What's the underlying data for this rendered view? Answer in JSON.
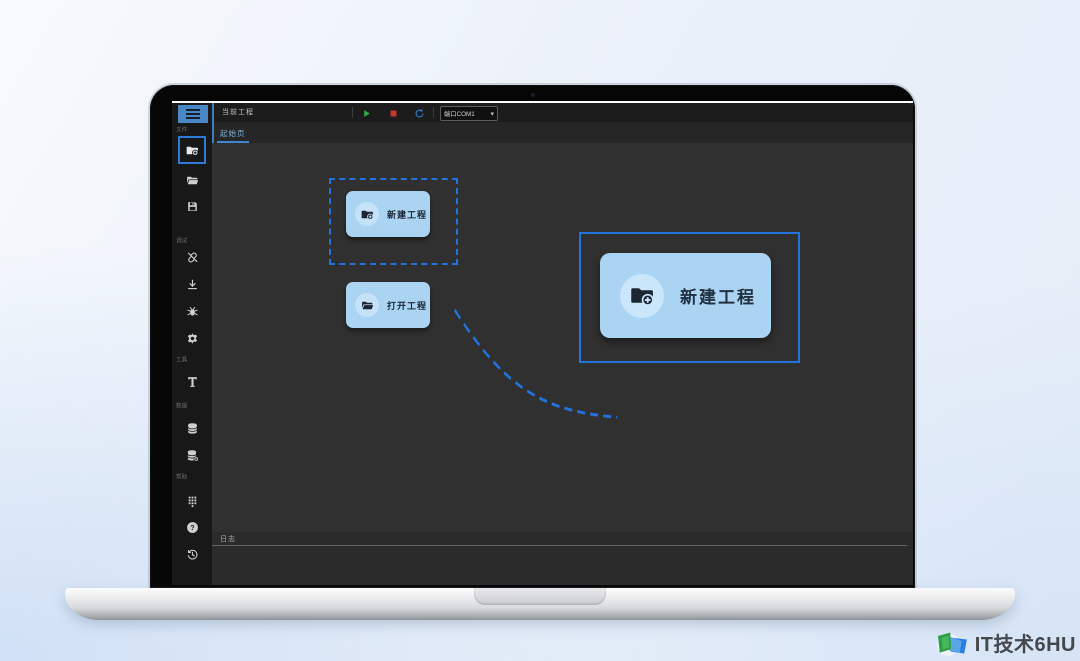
{
  "toolbar": {
    "project_label": "当前工程",
    "port_select_value": "端口COM1",
    "controls": [
      {
        "name": "run",
        "icon": "play-icon"
      },
      {
        "name": "stop",
        "icon": "stop-icon"
      },
      {
        "name": "restart",
        "icon": "restart-icon"
      }
    ]
  },
  "tabs": [
    {
      "label": "起始页",
      "active": true
    }
  ],
  "sidebar": {
    "sections": [
      {
        "label": "文件",
        "icons": [
          "folder-plus-icon",
          "folder-open-icon",
          "save-icon"
        ]
      },
      {
        "label": "调试",
        "icons": [
          "link-slash-icon",
          "download-icon",
          "bug-icon",
          "gear-icon"
        ]
      },
      {
        "label": "工具",
        "icons": [
          "text-icon"
        ]
      },
      {
        "label": "数据",
        "icons": [
          "database-icon",
          "database-plus-icon"
        ]
      },
      {
        "label": "帮助",
        "icons": [
          "grid-icon",
          "help-icon",
          "history-icon"
        ]
      }
    ],
    "selected_icon": "folder-plus-icon"
  },
  "canvas": {
    "new_project_button": "新建工程",
    "open_project_button": "打开工程",
    "callout_button": "新建工程"
  },
  "log_panel": {
    "label": "日志"
  },
  "watermark": {
    "text": "IT技术6HU"
  },
  "colors": {
    "accent_blue": "#2273dd",
    "selection_blue": "#2e7cd6",
    "button_bg": "#abd4f3",
    "button_icon_circle": "#c9e6fb",
    "play_green": "#2fae42",
    "stop_red": "#c9342b",
    "restart_blue": "#2f7fd4",
    "tab_underline": "#3f87cf",
    "hamburger_bg": "#4a87c7",
    "canvas_bg": "#303030"
  }
}
